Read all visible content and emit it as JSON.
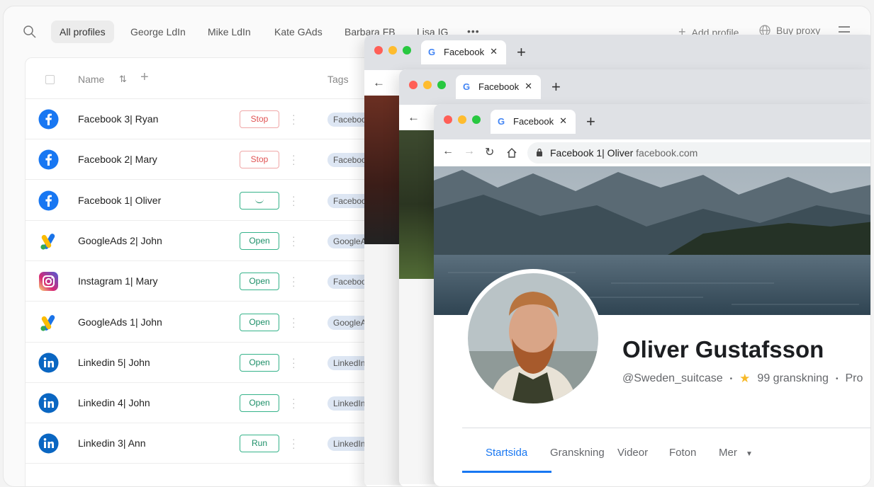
{
  "topbar": {
    "tabs": [
      "All profiles",
      "George LdIn",
      "Mike LdIn",
      "Kate GAds",
      "Barbara FB",
      "Lisa IG"
    ],
    "more": "•••",
    "add_profile": "Add profile",
    "buy_proxy": "Buy proxy"
  },
  "table": {
    "col_name": "Name",
    "col_tags": "Tags",
    "rows": [
      {
        "icon": "facebook-icon",
        "name": "Facebook 3| Ryan",
        "action": "Stop",
        "state": "stop",
        "tag": "Faceboo"
      },
      {
        "icon": "facebook-icon",
        "name": "Facebook 2| Mary",
        "action": "Stop",
        "state": "stop",
        "tag": "Faceboo"
      },
      {
        "icon": "facebook-icon",
        "name": "Facebook 1| Oliver",
        "action": "",
        "state": "loading",
        "tag": "Faceboo"
      },
      {
        "icon": "google-ads-icon",
        "name": "GoogleAds 2| John",
        "action": "Open",
        "state": "open",
        "tag": "GoogleA"
      },
      {
        "icon": "instagram-icon",
        "name": "Instagram 1| Mary",
        "action": "Open",
        "state": "open",
        "tag": "Faceboo"
      },
      {
        "icon": "google-ads-icon",
        "name": "GoogleAds 1| John",
        "action": "Open",
        "state": "open",
        "tag": "GoogleA"
      },
      {
        "icon": "linkedin-icon",
        "name": "Linkedin 5| John",
        "action": "Open",
        "state": "open",
        "tag": "LinkedIn"
      },
      {
        "icon": "linkedin-icon",
        "name": "Linkedin 4| John",
        "action": "Open",
        "state": "open",
        "tag": "LinkedIn"
      },
      {
        "icon": "linkedin-icon",
        "name": "Linkedin 3| Ann",
        "action": "Run",
        "state": "run",
        "tag": "LinkedIn"
      }
    ]
  },
  "browser": {
    "tab_title": "Facebook",
    "url_title": "Facebook 1| Oliver",
    "url_domain": "facebook.com"
  },
  "profile": {
    "name": "Oliver Gustafsson",
    "handle": "@Sweden_suitcase",
    "reviews": "99 granskning",
    "extra": "Pro",
    "tabs": [
      "Startsida",
      "Granskning",
      "Videor",
      "Foton",
      "Mer"
    ]
  },
  "colors": {
    "facebook": "#1877f2",
    "linkedin": "#0a66c2",
    "stop": "#e05252",
    "open": "#1d8f68",
    "tag_bg": "#dde6f3"
  }
}
